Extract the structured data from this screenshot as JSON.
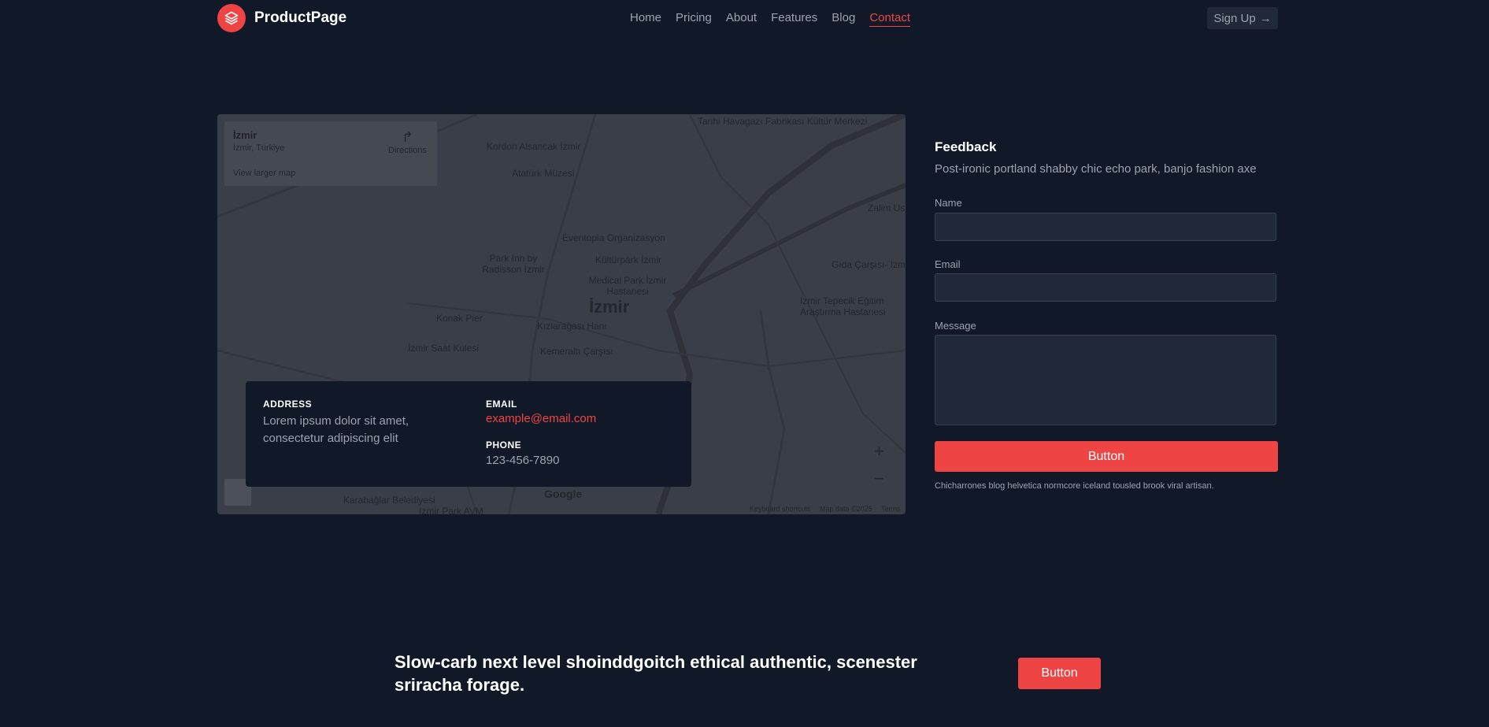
{
  "header": {
    "brand": "ProductPage",
    "nav": [
      {
        "label": "Home",
        "active": false
      },
      {
        "label": "Pricing",
        "active": false
      },
      {
        "label": "About",
        "active": false
      },
      {
        "label": "Features",
        "active": false
      },
      {
        "label": "Blog",
        "active": false
      },
      {
        "label": "Contact",
        "active": true
      }
    ],
    "signup_label": "Sign Up"
  },
  "map": {
    "place_title": "İzmir",
    "place_subtitle": "İzmir, Türkiye",
    "view_larger": "View larger map",
    "directions": "Directions",
    "city_label": "İzmir",
    "google": "Google",
    "footer": [
      "Keyboard shortcuts",
      "Map data ©2025",
      "Terms"
    ],
    "labels": [
      "Tarihi Havagazı Fabrikası Kültür Merkezi",
      "Kordon Alsancak İzmir",
      "Atatürk Müzesi",
      "Eventopia Organizasyon",
      "Kültürpark İzmir",
      "Park Inn by Radisson İzmir",
      "Medical Park İzmir Hastanesi",
      "Konak Pier",
      "Kızlarağası Hanı",
      "İzmir Saat Kulesi",
      "Kemeraltı Çarşısı",
      "Gıda Çarşısı- İzmir",
      "İzmir Tepecik Eğitim Araştırma Hastanesi",
      "Zalim Us",
      "Karabağlar Belediyesi",
      "İzmir Park AVM"
    ]
  },
  "contact": {
    "address_heading": "ADDRESS",
    "address_line1": "Lorem ipsum dolor sit amet,",
    "address_line2": "consectetur adipiscing elit",
    "email_heading": "EMAIL",
    "email": "example@email.com",
    "phone_heading": "PHONE",
    "phone": "123-456-7890"
  },
  "feedback": {
    "title": "Feedback",
    "description": "Post-ironic portland shabby chic echo park, banjo fashion axe",
    "name_label": "Name",
    "email_label": "Email",
    "message_label": "Message",
    "submit_label": "Button",
    "note": "Chicharrones blog helvetica normcore iceland tousled brook viral artisan."
  },
  "cta": {
    "text": "Slow-carb next level shoinddgoitch ethical authentic, scenester sriracha forage.",
    "button_label": "Button"
  },
  "colors": {
    "background": "#111827",
    "accent": "#ef4444",
    "input_bg": "#1f2937"
  }
}
